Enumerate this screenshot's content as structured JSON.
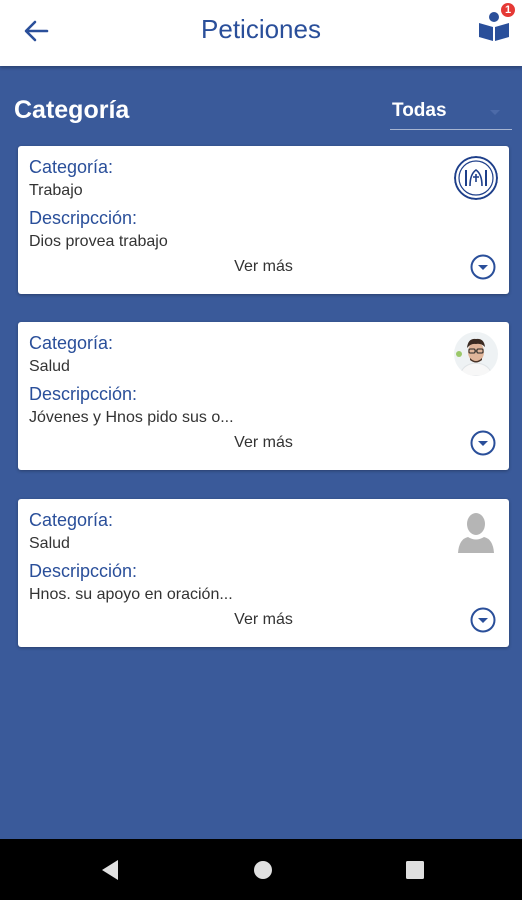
{
  "header": {
    "title": "Peticiones",
    "back_icon": "arrow-left-icon",
    "book_icon": "book-reader-icon",
    "notification_count": "1"
  },
  "filter": {
    "label": "Categoría",
    "selected": "Todas"
  },
  "cards": [
    {
      "category_label": "Categoría:",
      "category": "Trabajo",
      "description_label": "Descripcción:",
      "description": "Dios provea trabajo",
      "more": "Ver más",
      "avatar": "church-logo"
    },
    {
      "category_label": "Categoría:",
      "category": "Salud",
      "description_label": "Descripcción:",
      "description": "Jóvenes y Hnos pido sus o...",
      "more": "Ver más",
      "avatar": "person-photo"
    },
    {
      "category_label": "Categoría:",
      "category": "Salud",
      "description_label": "Descripcción:",
      "description": "Hnos. su apoyo en oración...",
      "more": "Ver más",
      "avatar": "default-person"
    }
  ],
  "colors": {
    "primary": "#2a4f9a",
    "background": "#3a5a9a",
    "badge": "#e53935"
  },
  "system_nav": [
    "back-triangle-icon",
    "home-circle-icon",
    "recents-square-icon"
  ]
}
